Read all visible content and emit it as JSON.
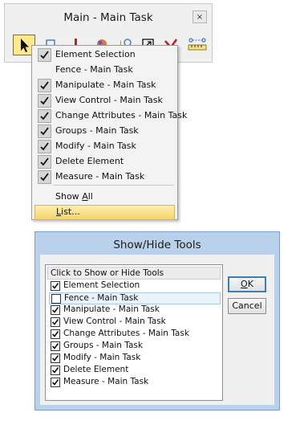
{
  "toolbar_window": {
    "title": "Main - Main Task",
    "close_label": "×"
  },
  "menu": {
    "items": [
      {
        "label": "Element Selection",
        "checked": true
      },
      {
        "label": "Fence - Main Task",
        "checked": false
      },
      {
        "label": "Manipulate - Main Task",
        "checked": true
      },
      {
        "label": "View Control - Main Task",
        "checked": true
      },
      {
        "label": "Change Attributes - Main Task",
        "checked": true
      },
      {
        "label": "Groups - Main Task",
        "checked": true
      },
      {
        "label": "Modify - Main Task",
        "checked": true
      },
      {
        "label": "Delete Element",
        "checked": true
      },
      {
        "label": "Measure - Main Task",
        "checked": true
      }
    ],
    "show_all_prefix": "Show ",
    "show_all_mnemonic": "A",
    "show_all_suffix": "ll",
    "list_mnemonic": "L",
    "list_suffix": "ist..."
  },
  "dialog": {
    "title": "Show/Hide Tools",
    "list_header": "Click to Show or Hide Tools",
    "ok_mnemonic": "O",
    "ok_suffix": "K",
    "cancel_label": "Cancel",
    "items": [
      {
        "label": "Element Selection",
        "checked": true
      },
      {
        "label": "Fence - Main Task",
        "checked": false
      },
      {
        "label": "Manipulate - Main Task",
        "checked": true
      },
      {
        "label": "View Control - Main Task",
        "checked": true
      },
      {
        "label": "Change Attributes - Main Task",
        "checked": true
      },
      {
        "label": "Groups - Main Task",
        "checked": true
      },
      {
        "label": "Modify - Main Task",
        "checked": true
      },
      {
        "label": "Delete Element",
        "checked": true
      },
      {
        "label": "Measure - Main Task",
        "checked": true
      }
    ]
  }
}
